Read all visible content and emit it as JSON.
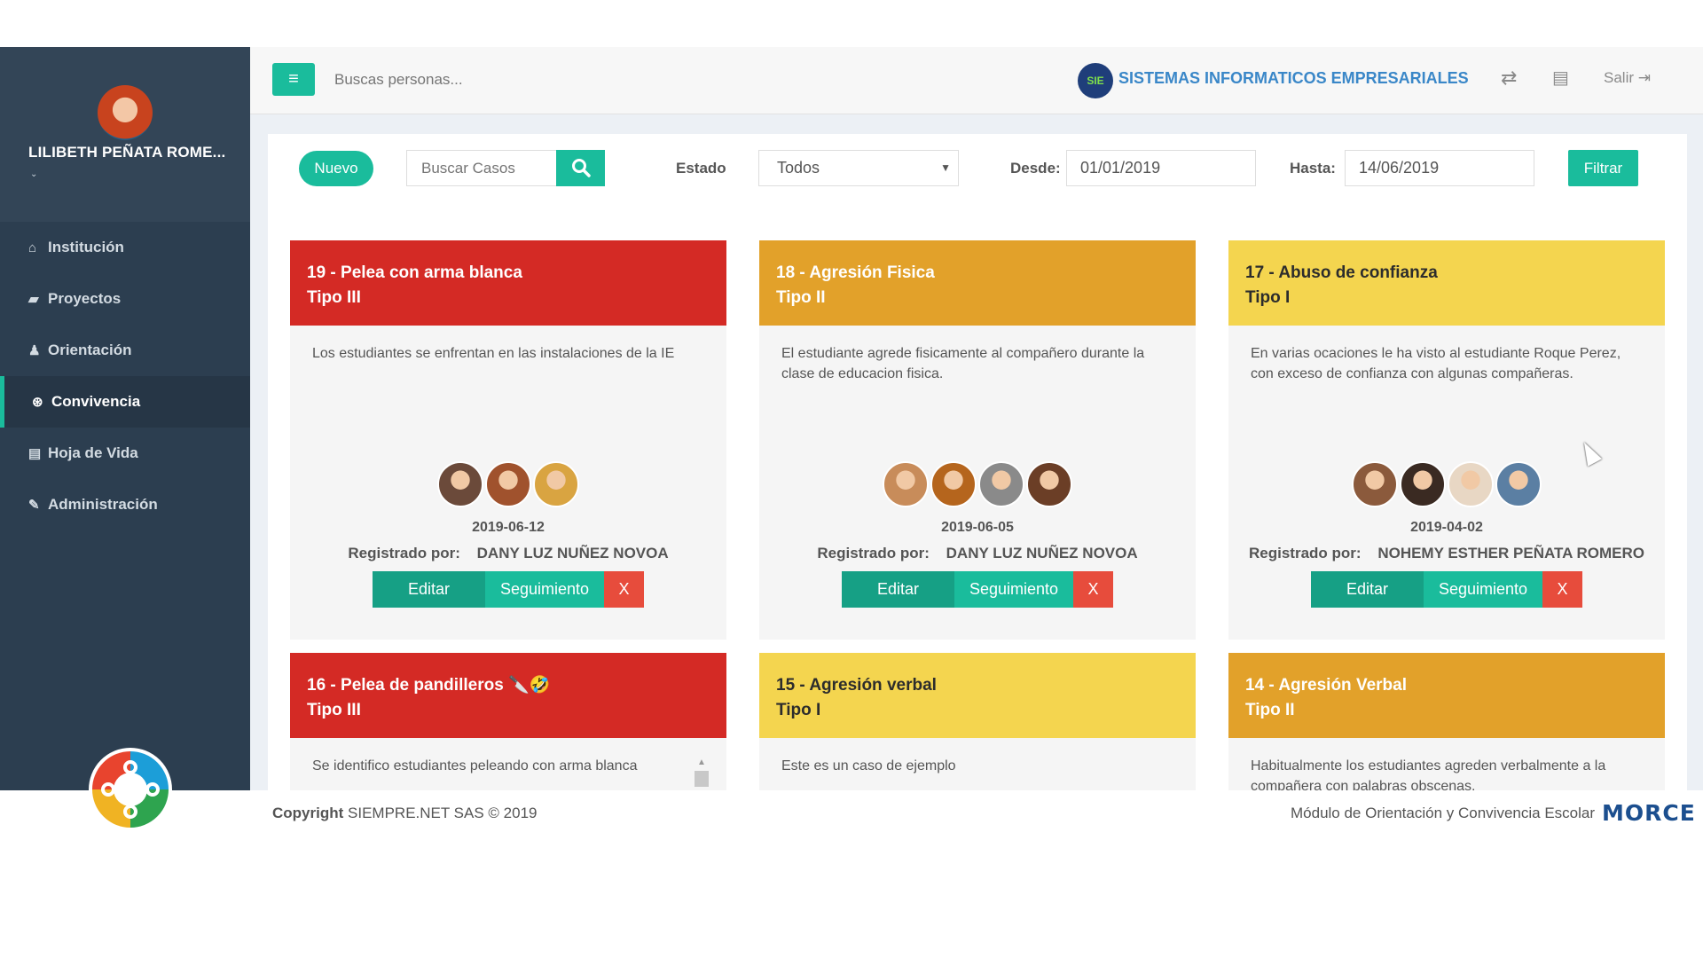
{
  "user": {
    "name": "LILIBETH PEÑATA ROME...",
    "caret": "⌄"
  },
  "sidebar": {
    "items": [
      {
        "label": "Institución",
        "icon": "home-icon"
      },
      {
        "label": "Proyectos",
        "icon": "briefcase-icon"
      },
      {
        "label": "Orientación",
        "icon": "user-icon"
      },
      {
        "label": "Convivencia",
        "icon": "life-ring-icon",
        "active": true
      },
      {
        "label": "Hoja de Vida",
        "icon": "file-icon"
      },
      {
        "label": "Administración",
        "icon": "wrench-icon"
      }
    ]
  },
  "topbar": {
    "search_placeholder": "Buscas personas...",
    "brand_logo_text": "SIE",
    "brand_name": "SISTEMAS INFORMATICOS EMPRESARIALES",
    "logout_label": "Salir"
  },
  "filters": {
    "new_label": "Nuevo",
    "search_placeholder": "Buscar Casos",
    "estado_label": "Estado",
    "estado_value": "Todos",
    "desde_label": "Desde:",
    "desde_value": "01/01/2019",
    "hasta_label": "Hasta:",
    "hasta_value": "14/06/2019",
    "filter_label": "Filtrar"
  },
  "cards": [
    {
      "title": "19 - Pelea con arma blanca",
      "type": "Tipo III",
      "color": "#d42a25",
      "description": "Los estudiantes se enfrentan en las instalaciones de la IE",
      "avatar_count": 3,
      "date": "2019-06-12",
      "registered_label": "Registrado por:",
      "registered_by": "DANY LUZ NUÑEZ NOVOA",
      "edit_label": "Editar",
      "follow_label": "Seguimiento",
      "delete_label": "X"
    },
    {
      "title": "18 - Agresión Fisica",
      "type": "Tipo II",
      "color": "#e2a12a",
      "description": "El estudiante agrede fisicamente al compañero durante la clase de educacion fisica.",
      "avatar_count": 4,
      "date": "2019-06-05",
      "registered_label": "Registrado por:",
      "registered_by": "DANY LUZ NUÑEZ NOVOA",
      "edit_label": "Editar",
      "follow_label": "Seguimiento",
      "delete_label": "X"
    },
    {
      "title": "17 - Abuso de confianza",
      "type": "Tipo I",
      "color": "#f4d54f",
      "description": "En varias ocaciones le ha visto al estudiante Roque Perez, con exceso de confianza con algunas compañeras.",
      "avatar_count": 4,
      "date": "2019-04-02",
      "registered_label": "Registrado por:",
      "registered_by": "NOHEMY ESTHER PEÑATA ROMERO",
      "edit_label": "Editar",
      "follow_label": "Seguimiento",
      "delete_label": "X"
    },
    {
      "title": "16 - Pelea de pandilleros 🔪🤣",
      "type": "Tipo III",
      "color": "#d42a25",
      "description": "Se identifico estudiantes peleando con arma blanca"
    },
    {
      "title": "15 - Agresión verbal",
      "type": "Tipo I",
      "color": "#f4d54f",
      "description": "Este es un caso de ejemplo"
    },
    {
      "title": "14 - Agresión Verbal",
      "type": "Tipo II",
      "color": "#e2a12a",
      "description": "Habitualmente los estudiantes agreden verbalmente a la compañera con palabras obscenas."
    }
  ],
  "footer": {
    "copyright_label": "Copyright",
    "copyright_text": "SIEMPRE.NET SAS © 2019",
    "module_name": "Módulo de Orientación y Convivencia Escolar",
    "logo_text": "MORCE"
  },
  "colors": {
    "accent": "#1abc9c",
    "sidebar": "#2c3e50",
    "danger": "#e74c3c",
    "brand": "#3a87c8"
  }
}
